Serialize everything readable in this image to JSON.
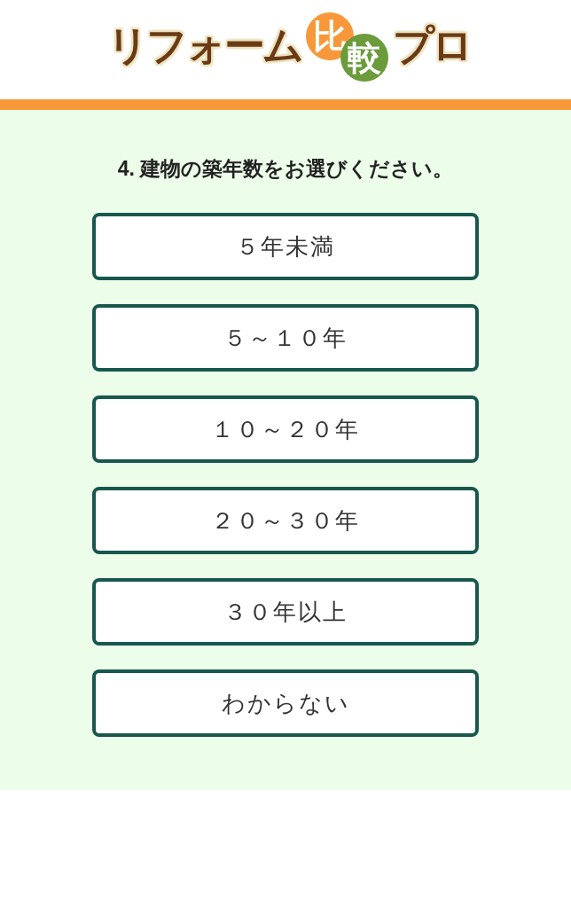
{
  "logo": {
    "parts": [
      {
        "text": "リフォーム",
        "kind": "plain"
      },
      {
        "text": "比",
        "kind": "disc",
        "color": "#f8983a"
      },
      {
        "text": "較",
        "kind": "disc",
        "color": "#6b9b3a"
      },
      {
        "text": "プロ",
        "kind": "plain"
      }
    ]
  },
  "question": {
    "text": "4. 建物の築年数をお選びください。"
  },
  "options": [
    {
      "label": "５年未満"
    },
    {
      "label": "５～１０年"
    },
    {
      "label": "１０～２０年"
    },
    {
      "label": "２０～３０年"
    },
    {
      "label": "３０年以上"
    },
    {
      "label": "わからない"
    }
  ]
}
